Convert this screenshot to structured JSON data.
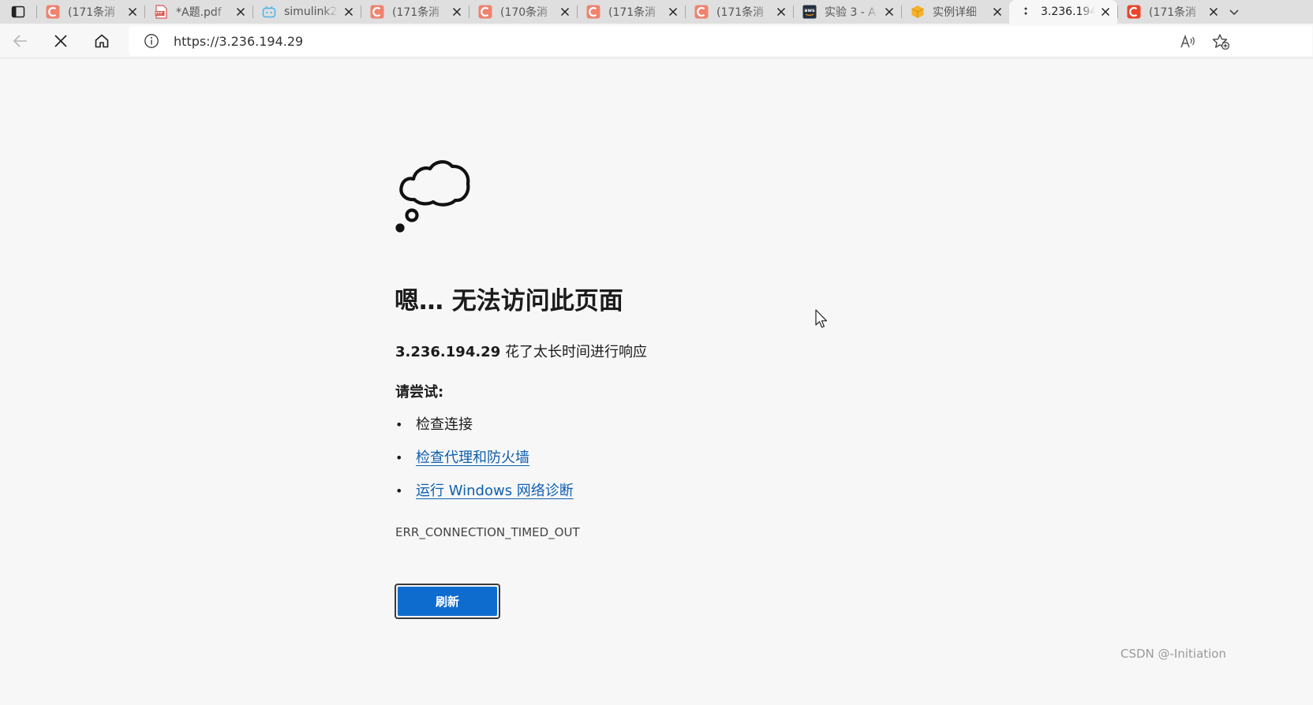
{
  "browser": {
    "tabs": [
      {
        "title": "(171条消",
        "favicon": "csdn-icon",
        "color": "#f0836f"
      },
      {
        "title": "*A题.pdf",
        "favicon": "pdf-icon",
        "color": "#d9534f"
      },
      {
        "title": "simulink2",
        "favicon": "bilibili-icon",
        "color": "#4fb4e8"
      },
      {
        "title": "(171条消",
        "favicon": "csdn-icon",
        "color": "#f0836f"
      },
      {
        "title": "(170条消",
        "favicon": "csdn-icon",
        "color": "#f0836f"
      },
      {
        "title": "(171条消",
        "favicon": "csdn-icon",
        "color": "#f0836f"
      },
      {
        "title": "(171条消",
        "favicon": "csdn-icon",
        "color": "#f0836f"
      },
      {
        "title": "实验 3 - A",
        "favicon": "aws-icon",
        "color": "#232f3e"
      },
      {
        "title": "实例详细",
        "favicon": "cube-icon",
        "color": "#f3b229"
      },
      {
        "title": "3.236.194",
        "favicon": "loading-icon",
        "active": true
      },
      {
        "title": "(171条消",
        "favicon": "csdn-icon",
        "color": "#e9462d"
      }
    ],
    "address_url": "https://3.236.194.29"
  },
  "error": {
    "heading": "嗯… 无法访问此页面",
    "host": "3.236.194.29",
    "message": " 花了太长时间进行响应",
    "try_label": "请尝试:",
    "suggestions": {
      "check_connection": "检查连接",
      "check_proxy": "检查代理和防火墙",
      "run_diagnostics": "运行 Windows 网络诊断"
    },
    "code": "ERR_CONNECTION_TIMED_OUT",
    "refresh_label": "刷新"
  },
  "watermark": "CSDN @-Initiation",
  "colors": {
    "accent": "#0f6ccf",
    "link": "#0f5fb0",
    "background": "#f7f7f7"
  }
}
